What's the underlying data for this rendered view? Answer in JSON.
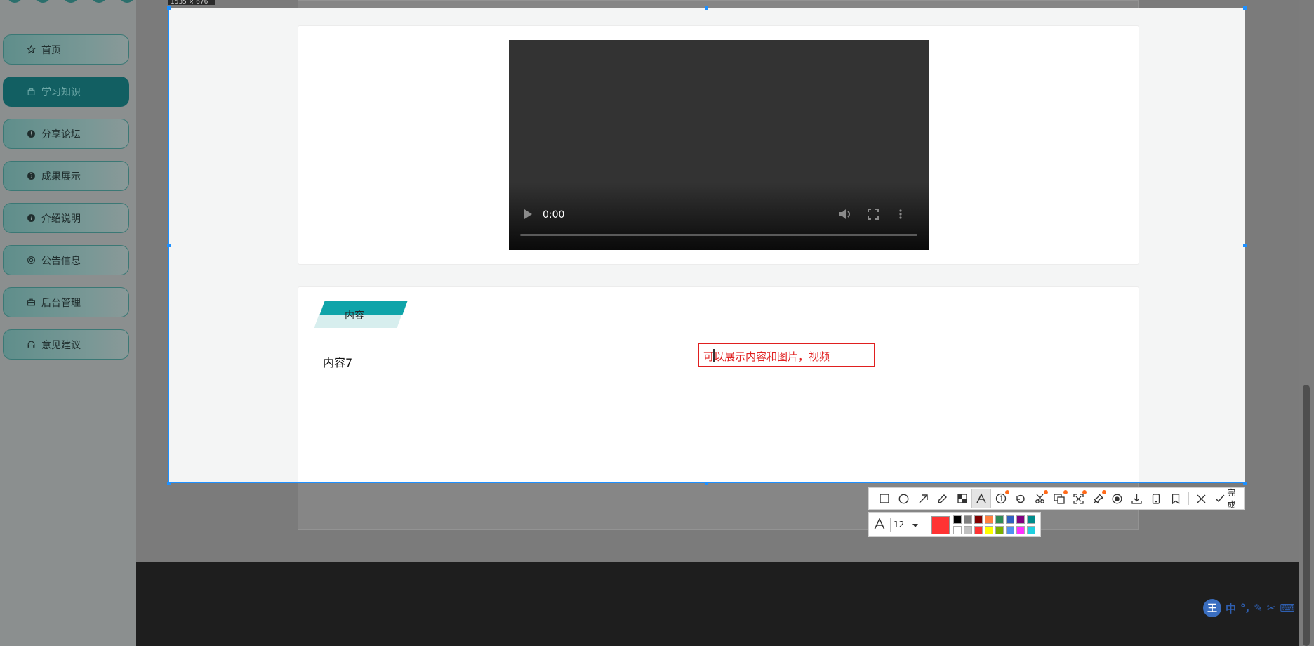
{
  "sidebar": {
    "items": [
      {
        "label": "首页",
        "icon": "star-icon",
        "active": false
      },
      {
        "label": "学习知识",
        "icon": "bag-icon",
        "active": true
      },
      {
        "label": "分享论坛",
        "icon": "alert-circle-icon",
        "active": false
      },
      {
        "label": "成果展示",
        "icon": "question-circle-icon",
        "active": false
      },
      {
        "label": "介绍说明",
        "icon": "info-circle-icon",
        "active": false
      },
      {
        "label": "公告信息",
        "icon": "at-icon",
        "active": false
      },
      {
        "label": "后台管理",
        "icon": "briefcase-icon",
        "active": false
      },
      {
        "label": "意见建议",
        "icon": "headset-icon",
        "active": false
      }
    ]
  },
  "video": {
    "time": "0:00"
  },
  "content": {
    "tab_label": "内容",
    "text": "内容7"
  },
  "annotation": {
    "text": "可以展示内容和图片，视频"
  },
  "capture": {
    "size_label": "1535 × 676"
  },
  "toolbar": {
    "tools": [
      "rectangle-icon",
      "ellipse-icon",
      "arrow-icon",
      "pencil-icon",
      "mosaic-icon",
      "text-icon",
      "number-marker-icon",
      "undo-icon",
      "scissors-icon",
      "ocr-icon",
      "scan-icon",
      "pin-icon",
      "record-icon",
      "download-icon",
      "phone-icon",
      "bookmark-icon"
    ],
    "selected_tool": "text-icon",
    "done_label": "完成"
  },
  "text_options": {
    "font_size": "12",
    "current_color": "#ff3333",
    "palette": [
      "#000000",
      "#808080",
      "#800000",
      "#ff8040",
      "#2e8b57",
      "#3060c0",
      "#800080",
      "#008b8b",
      "#ffffff",
      "#c0c0c0",
      "#ff3333",
      "#ffff00",
      "#7cb000",
      "#5090f0",
      "#ff30ff",
      "#20d0e0"
    ]
  },
  "ime": {
    "mode_label": "中"
  }
}
